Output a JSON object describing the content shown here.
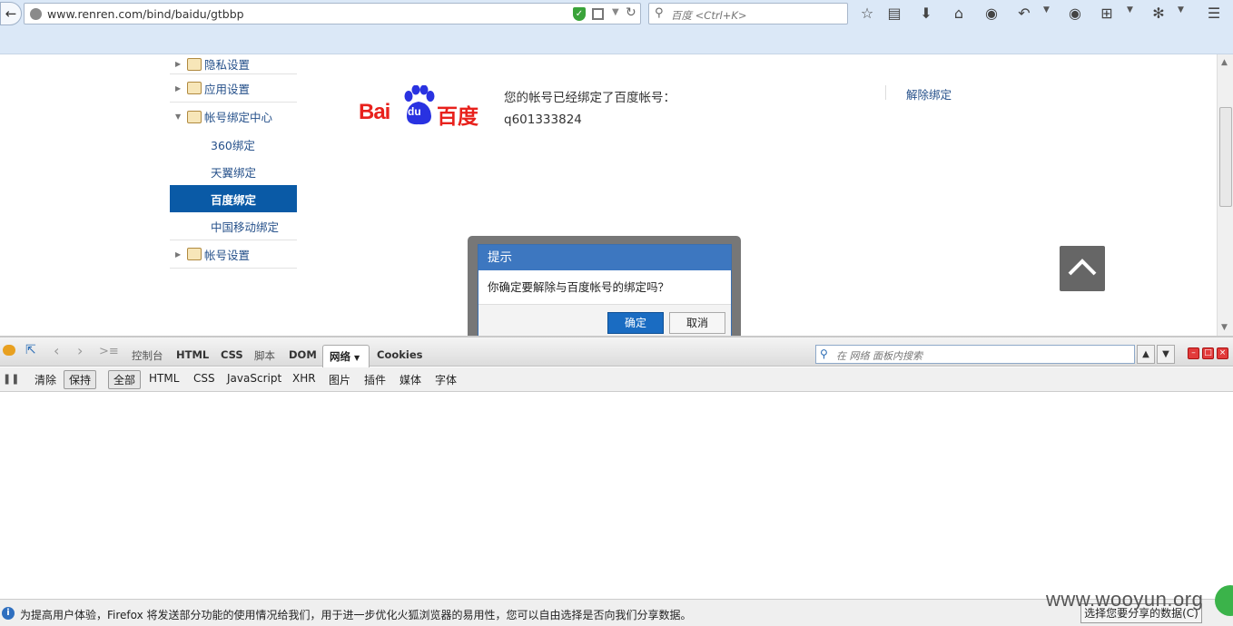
{
  "browser": {
    "url": "www.renren.com/bind/baidu/gtbbp",
    "search_placeholder": "百度 <Ctrl+K>"
  },
  "sidebar": {
    "privacy": "隐私设置",
    "apps": "应用设置",
    "binding_center": "帐号绑定中心",
    "sub_items": [
      "360绑定",
      "天翼绑定",
      "百度绑定",
      "中国移动绑定"
    ],
    "account": "帐号设置"
  },
  "main": {
    "logo_text_latin": "Bai",
    "logo_text_du": "du",
    "logo_text_cn": "百度",
    "bound_message": "您的帐号已经绑定了百度帐号：",
    "bound_account": "q601333824",
    "unbind_link": "解除绑定"
  },
  "dialog": {
    "title": "提示",
    "message": "你确定要解除与百度帐号的绑定吗？",
    "ok": "确定",
    "cancel": "取消"
  },
  "firebug": {
    "tabs": [
      "控制台",
      "HTML",
      "CSS",
      "脚本",
      "DOM"
    ],
    "active_tab": "网络",
    "cookies_tab": "Cookies",
    "search_placeholder": "在 网络 面板内搜索",
    "clear": "清除",
    "persist": "保持",
    "filters": [
      "全部",
      "HTML",
      "CSS",
      "JavaScript",
      "XHR",
      "图片",
      "插件",
      "媒体",
      "字体"
    ]
  },
  "notification": {
    "text": "为提高用户体验，Firefox 将发送部分功能的使用情况给我们，用于进一步优化火狐浏览器的易用性，您可以自由选择是否向我们分享数据。",
    "button": "选择您要分享的数据(C)"
  },
  "watermark": "www.wooyun.org",
  "colors": {
    "accent": "#0a5aa6",
    "dialog_header": "#3d77c0",
    "baidu_red": "#e8211c",
    "baidu_blue": "#2932e1"
  }
}
